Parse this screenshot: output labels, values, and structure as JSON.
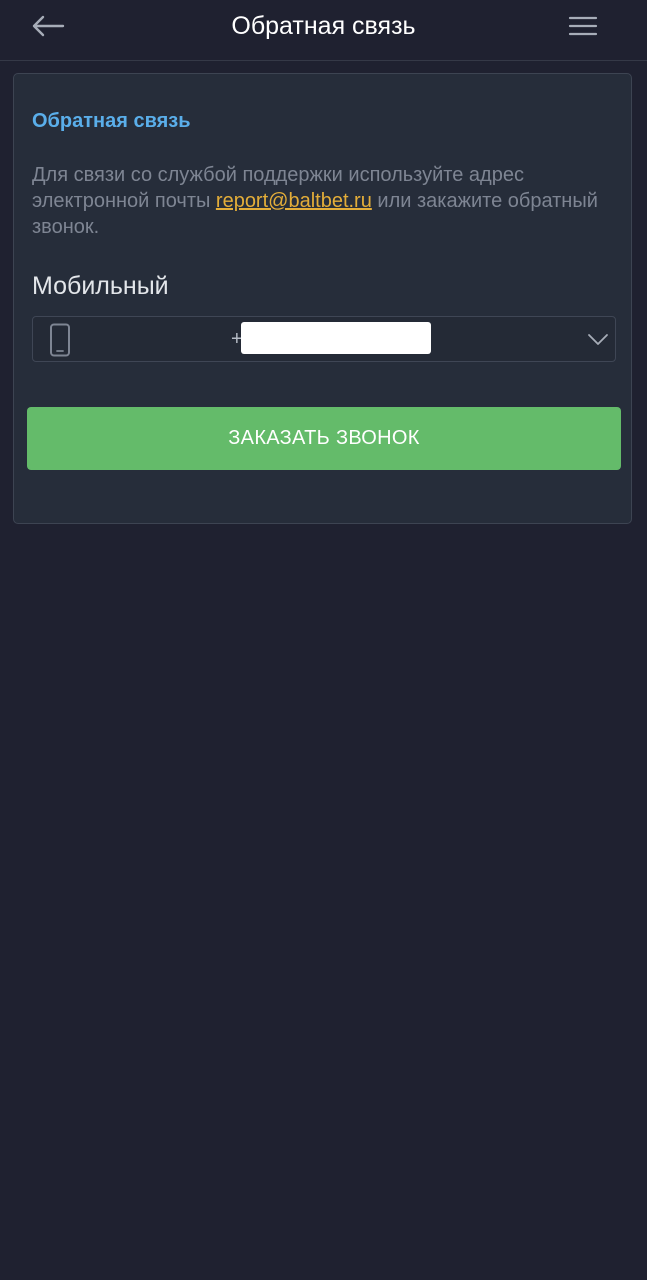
{
  "header": {
    "title": "Обратная связь",
    "back_icon": "arrow-left-icon",
    "menu_icon": "menu-icon"
  },
  "card": {
    "title": "Обратная связь",
    "description_before": "Для связи со службой поддержки используйте адрес электронной почты ",
    "email": "report@baltbet.ru",
    "description_after": " или закажите обратный звонок.",
    "phone_label": "Мобильный",
    "phone_value": "+",
    "phone_icon": "smartphone-icon",
    "dropdown_icon": "chevron-down-icon",
    "submit_label": "ЗАКАЗАТЬ ЗВОНОК"
  },
  "colors": {
    "background": "#1f2130",
    "card": "#262d3a",
    "accent_blue": "#5aaeea",
    "link_orange": "#e3ad39",
    "button_green": "#64bb6a"
  }
}
